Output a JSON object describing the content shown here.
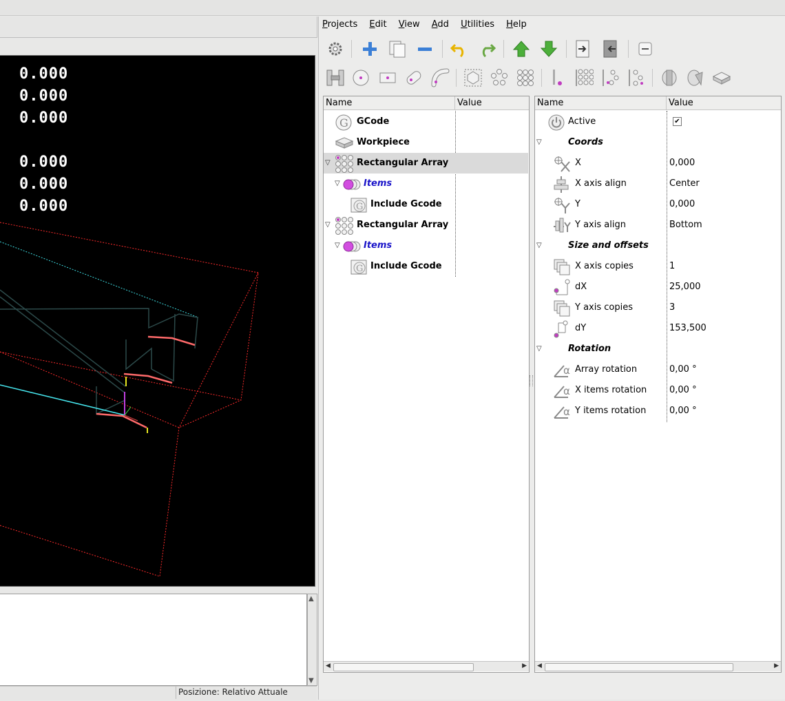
{
  "viewport": {
    "coords": [
      "0.000",
      "0.000",
      "0.000",
      "0.000",
      "0.000",
      "0.000"
    ]
  },
  "status": {
    "position": "Posizione: Relativo Attuale"
  },
  "menu": [
    {
      "label": "Projects",
      "key": "P",
      "rest": "rojects"
    },
    {
      "label": "Edit",
      "key": "E",
      "rest": "dit"
    },
    {
      "label": "View",
      "key": "V",
      "rest": "iew"
    },
    {
      "label": "Add",
      "key": "A",
      "rest": "dd"
    },
    {
      "label": "Utilities",
      "key": "U",
      "rest": "tilities"
    },
    {
      "label": "Help",
      "key": "H",
      "rest": "elp"
    }
  ],
  "toolbar1": [
    "gear-icon",
    "add-icon",
    "copy-icon",
    "remove-icon",
    "undo-icon",
    "redo-icon",
    "move-up-icon",
    "move-down-icon",
    "indent-icon",
    "unindent-icon",
    "collapse-icon"
  ],
  "toolbar2": [
    "drill-icon",
    "circle-icon",
    "rectangle-icon",
    "slot-icon",
    "arc-slot-icon",
    "hexagon-icon",
    "circular-array-icon",
    "grid-array-icon",
    "drill-point-icon",
    "rect-array-icon",
    "polar-array-icon",
    "offset-array-icon",
    "tool-icon",
    "tool-change-icon",
    "workpiece-icon"
  ],
  "project_tree": {
    "col_name": "Name",
    "col_value": "Value",
    "rows": [
      {
        "label": "GCode",
        "style": "bold"
      },
      {
        "label": "Workpiece",
        "style": "bold"
      },
      {
        "label": "Rectangular Array",
        "style": "bold"
      },
      {
        "label": "Items",
        "style": "blueit"
      },
      {
        "label": "Include Gcode",
        "style": "bold"
      },
      {
        "label": "Rectangular Array",
        "style": "bold"
      },
      {
        "label": "Items",
        "style": "blueit"
      },
      {
        "label": "Include Gcode",
        "style": "bold"
      }
    ]
  },
  "props": {
    "col_name": "Name",
    "col_value": "Value",
    "rows": [
      {
        "name": "Active",
        "value": "✔"
      },
      {
        "name": "Coords",
        "value": ""
      },
      {
        "name": "X",
        "value": "0,000"
      },
      {
        "name": "X axis align",
        "value": "Center"
      },
      {
        "name": "Y",
        "value": "0,000"
      },
      {
        "name": "Y axis align",
        "value": "Bottom"
      },
      {
        "name": "Size and offsets",
        "value": ""
      },
      {
        "name": "X axis copies",
        "value": "1"
      },
      {
        "name": "dX",
        "value": "25,000"
      },
      {
        "name": "Y axis copies",
        "value": "3"
      },
      {
        "name": "dY",
        "value": "153,500"
      },
      {
        "name": "Rotation",
        "value": ""
      },
      {
        "name": "Array rotation",
        "value": "0,00 °"
      },
      {
        "name": "X items rotation",
        "value": "0,00 °"
      },
      {
        "name": "Y items rotation",
        "value": "0,00 °"
      }
    ]
  },
  "colors": {
    "accent_items": "#1a14c9",
    "viewport_bg": "#000000",
    "path_red": "#ff2b2b",
    "path_cyan": "#3fe0e6"
  }
}
